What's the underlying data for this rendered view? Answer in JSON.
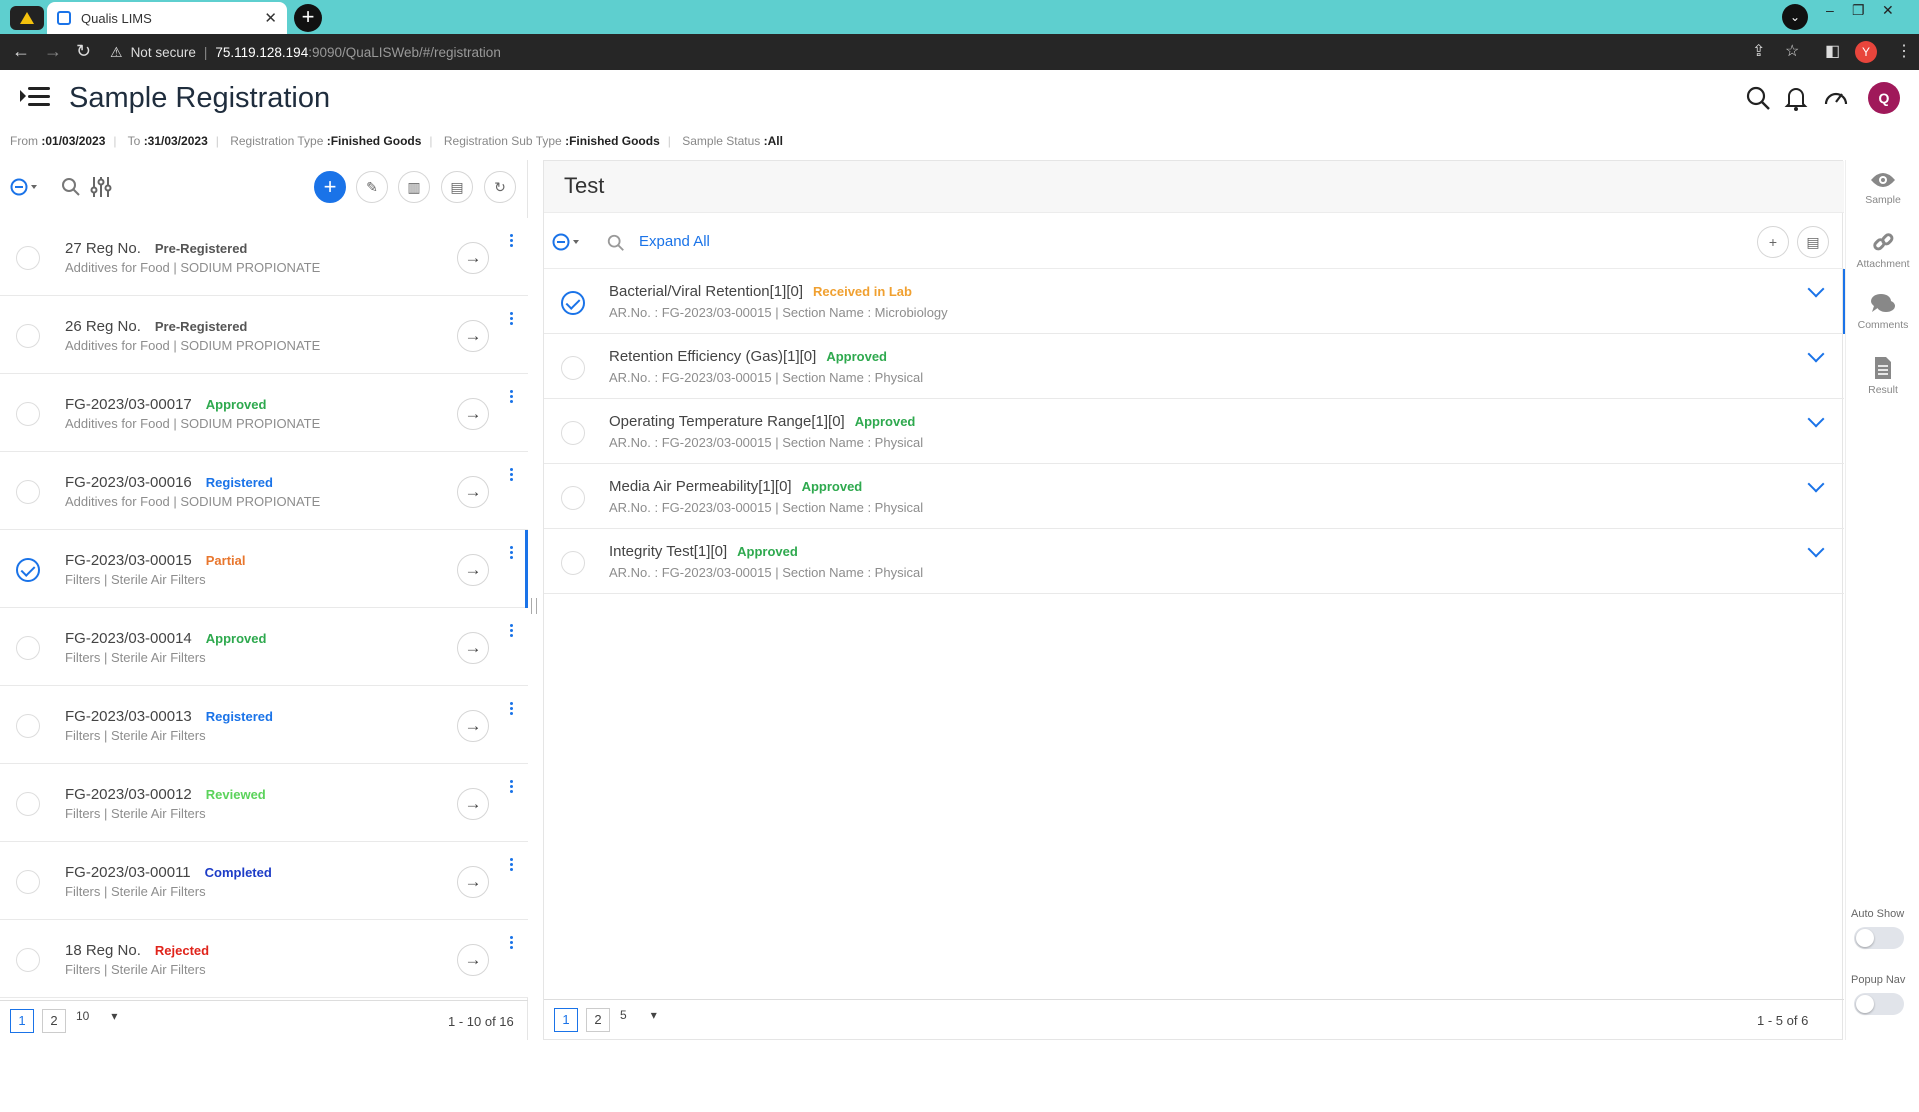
{
  "browser": {
    "tab_title": "Qualis LIMS",
    "address": {
      "warning": "Not secure",
      "host": "75.119.128.194",
      "path": ":9090/QuaLISWeb/#/registration"
    },
    "profile_initial": "Y"
  },
  "header": {
    "title": "Sample Registration",
    "avatar_initial": "Q"
  },
  "filters": {
    "from_label": "From",
    "from_value": ":01/03/2023",
    "to_label": "To",
    "to_value": ":31/03/2023",
    "reg_type_label": "Registration Type",
    "reg_type_value": ":Finished Goods",
    "reg_subtype_label": "Registration Sub Type",
    "reg_subtype_value": ":Finished Goods",
    "status_label": "Sample Status",
    "status_value": ":All"
  },
  "samples": [
    {
      "name": "27 Reg No.",
      "status": "Pre-Registered",
      "status_class": "s-pre",
      "sub": "Additives for Food | SODIUM PROPIONATE",
      "selected": false
    },
    {
      "name": "26 Reg No.",
      "status": "Pre-Registered",
      "status_class": "s-pre",
      "sub": "Additives for Food | SODIUM PROPIONATE",
      "selected": false
    },
    {
      "name": "FG-2023/03-00017",
      "status": "Approved",
      "status_class": "s-app",
      "sub": "Additives for Food | SODIUM PROPIONATE",
      "selected": false
    },
    {
      "name": "FG-2023/03-00016",
      "status": "Registered",
      "status_class": "s-reg",
      "sub": "Additives for Food | SODIUM PROPIONATE",
      "selected": false
    },
    {
      "name": "FG-2023/03-00015",
      "status": "Partial",
      "status_class": "s-part",
      "sub": "Filters | Sterile Air Filters",
      "selected": true
    },
    {
      "name": "FG-2023/03-00014",
      "status": "Approved",
      "status_class": "s-app",
      "sub": "Filters | Sterile Air Filters",
      "selected": false
    },
    {
      "name": "FG-2023/03-00013",
      "status": "Registered",
      "status_class": "s-reg",
      "sub": "Filters | Sterile Air Filters",
      "selected": false
    },
    {
      "name": "FG-2023/03-00012",
      "status": "Reviewed",
      "status_class": "s-rev",
      "sub": "Filters | Sterile Air Filters",
      "selected": false
    },
    {
      "name": "FG-2023/03-00011",
      "status": "Completed",
      "status_class": "s-comp",
      "sub": "Filters | Sterile Air Filters",
      "selected": false
    },
    {
      "name": "18 Reg No.",
      "status": "Rejected",
      "status_class": "s-rej",
      "sub": "Filters | Sterile Air Filters",
      "selected": false
    }
  ],
  "left_pager": {
    "page1": "1",
    "page2": "2",
    "size": "10",
    "count": "1 - 10 of 16"
  },
  "test_panel": {
    "title": "Test",
    "expand_all": "Expand All",
    "tests": [
      {
        "name": "Bacterial/Viral Retention[1][0]",
        "status": "Received in Lab",
        "status_class": "s-lab",
        "sub": "AR.No. : FG-2023/03-00015 | Section Name : Microbiology",
        "selected": true
      },
      {
        "name": "Retention Efficiency (Gas)[1][0]",
        "status": "Approved",
        "status_class": "s-app",
        "sub": "AR.No. : FG-2023/03-00015 | Section Name : Physical",
        "selected": false
      },
      {
        "name": "Operating Temperature Range[1][0]",
        "status": "Approved",
        "status_class": "s-app",
        "sub": "AR.No. : FG-2023/03-00015 | Section Name : Physical",
        "selected": false
      },
      {
        "name": "Media Air Permeability[1][0]",
        "status": "Approved",
        "status_class": "s-app",
        "sub": "AR.No. : FG-2023/03-00015 | Section Name : Physical",
        "selected": false
      },
      {
        "name": "Integrity Test[1][0]",
        "status": "Approved",
        "status_class": "s-app",
        "sub": "AR.No. : FG-2023/03-00015 | Section Name : Physical",
        "selected": false
      }
    ],
    "pager": {
      "page1": "1",
      "page2": "2",
      "size": "5",
      "count": "1 - 5 of 6"
    }
  },
  "rail": {
    "sample": "Sample",
    "attachment": "Attachment",
    "comments": "Comments",
    "result": "Result",
    "auto_show": "Auto Show",
    "popup_nav": "Popup Nav"
  },
  "colors": {
    "accent": "#1a73e8",
    "tab_bar": "#5ecfcf",
    "avatar": "#a0195a"
  }
}
